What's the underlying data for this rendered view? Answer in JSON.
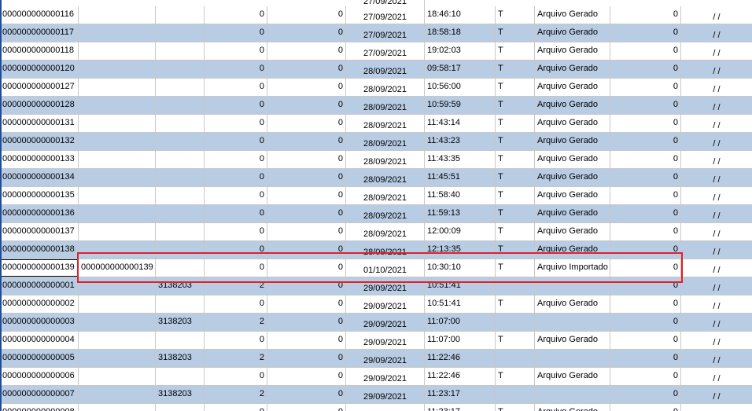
{
  "colors": {
    "row_alt": "#b8cce4",
    "row_plain": "#ffffff",
    "highlight": "#e0202a"
  },
  "top_partial_date": "27/09/2021",
  "rows": [
    {
      "c0": "000000000000116",
      "c1": "",
      "c2": "",
      "c3": "0",
      "c4": "0",
      "c5": "27/09/2021",
      "c6": "18:46:10",
      "c7": "T",
      "c8": "Arquivo Gerado",
      "c9": "0",
      "c10": "/ /"
    },
    {
      "c0": "000000000000117",
      "c1": "",
      "c2": "",
      "c3": "0",
      "c4": "0",
      "c5": "27/09/2021",
      "c6": "18:58:18",
      "c7": "T",
      "c8": "Arquivo Gerado",
      "c9": "0",
      "c10": "/ /"
    },
    {
      "c0": "000000000000118",
      "c1": "",
      "c2": "",
      "c3": "0",
      "c4": "0",
      "c5": "27/09/2021",
      "c6": "19:02:03",
      "c7": "T",
      "c8": "Arquivo Gerado",
      "c9": "0",
      "c10": "/ /"
    },
    {
      "c0": "000000000000120",
      "c1": "",
      "c2": "",
      "c3": "0",
      "c4": "0",
      "c5": "28/09/2021",
      "c6": "09:58:17",
      "c7": "T",
      "c8": "Arquivo Gerado",
      "c9": "0",
      "c10": "/ /"
    },
    {
      "c0": "000000000000127",
      "c1": "",
      "c2": "",
      "c3": "0",
      "c4": "0",
      "c5": "28/09/2021",
      "c6": "10:56:00",
      "c7": "T",
      "c8": "Arquivo Gerado",
      "c9": "0",
      "c10": "/ /"
    },
    {
      "c0": "000000000000128",
      "c1": "",
      "c2": "",
      "c3": "0",
      "c4": "0",
      "c5": "28/09/2021",
      "c6": "10:59:59",
      "c7": "T",
      "c8": "Arquivo Gerado",
      "c9": "0",
      "c10": "/ /"
    },
    {
      "c0": "000000000000131",
      "c1": "",
      "c2": "",
      "c3": "0",
      "c4": "0",
      "c5": "28/09/2021",
      "c6": "11:43:14",
      "c7": "T",
      "c8": "Arquivo Gerado",
      "c9": "0",
      "c10": "/ /"
    },
    {
      "c0": "000000000000132",
      "c1": "",
      "c2": "",
      "c3": "0",
      "c4": "0",
      "c5": "28/09/2021",
      "c6": "11:43:23",
      "c7": "T",
      "c8": "Arquivo Gerado",
      "c9": "0",
      "c10": "/ /"
    },
    {
      "c0": "000000000000133",
      "c1": "",
      "c2": "",
      "c3": "0",
      "c4": "0",
      "c5": "28/09/2021",
      "c6": "11:43:35",
      "c7": "T",
      "c8": "Arquivo Gerado",
      "c9": "0",
      "c10": "/ /"
    },
    {
      "c0": "000000000000134",
      "c1": "",
      "c2": "",
      "c3": "0",
      "c4": "0",
      "c5": "28/09/2021",
      "c6": "11:45:51",
      "c7": "T",
      "c8": "Arquivo Gerado",
      "c9": "0",
      "c10": "/ /"
    },
    {
      "c0": "000000000000135",
      "c1": "",
      "c2": "",
      "c3": "0",
      "c4": "0",
      "c5": "28/09/2021",
      "c6": "11:58:40",
      "c7": "T",
      "c8": "Arquivo Gerado",
      "c9": "0",
      "c10": "/ /"
    },
    {
      "c0": "000000000000136",
      "c1": "",
      "c2": "",
      "c3": "0",
      "c4": "0",
      "c5": "28/09/2021",
      "c6": "11:59:13",
      "c7": "T",
      "c8": "Arquivo Gerado",
      "c9": "0",
      "c10": "/ /"
    },
    {
      "c0": "000000000000137",
      "c1": "",
      "c2": "",
      "c3": "0",
      "c4": "0",
      "c5": "28/09/2021",
      "c6": "12:00:09",
      "c7": "T",
      "c8": "Arquivo Gerado",
      "c9": "0",
      "c10": "/ /"
    },
    {
      "c0": "000000000000138",
      "c1": "",
      "c2": "",
      "c3": "0",
      "c4": "0",
      "c5": "28/09/2021",
      "c6": "12:13:35",
      "c7": "T",
      "c8": "Arquivo Gerado",
      "c9": "0",
      "c10": "/ /"
    },
    {
      "c0": "000000000000139",
      "c1": "000000000000139",
      "c2": "",
      "c3": "0",
      "c4": "0",
      "c5": "01/10/2021",
      "c6": "10:30:10",
      "c7": "T",
      "c8": "Arquivo Importado",
      "c9": "0",
      "c10": "/ /",
      "selected": true
    },
    {
      "c0": "000000000000001",
      "c1": "",
      "c2": "3138203",
      "c3": "2",
      "c4": "0",
      "c5": "29/09/2021",
      "c6": "10:51:41",
      "c7": "",
      "c8": "",
      "c9": "0",
      "c10": "/ /"
    },
    {
      "c0": "000000000000002",
      "c1": "",
      "c2": "",
      "c3": "0",
      "c4": "0",
      "c5": "29/09/2021",
      "c6": "10:51:41",
      "c7": "T",
      "c8": "Arquivo Gerado",
      "c9": "0",
      "c10": "/ /"
    },
    {
      "c0": "000000000000003",
      "c1": "",
      "c2": "3138203",
      "c3": "2",
      "c4": "0",
      "c5": "29/09/2021",
      "c6": "11:07:00",
      "c7": "",
      "c8": "",
      "c9": "0",
      "c10": "/ /"
    },
    {
      "c0": "000000000000004",
      "c1": "",
      "c2": "",
      "c3": "0",
      "c4": "0",
      "c5": "29/09/2021",
      "c6": "11:07:00",
      "c7": "T",
      "c8": "Arquivo Gerado",
      "c9": "0",
      "c10": "/ /"
    },
    {
      "c0": "000000000000005",
      "c1": "",
      "c2": "3138203",
      "c3": "2",
      "c4": "0",
      "c5": "29/09/2021",
      "c6": "11:22:46",
      "c7": "",
      "c8": "",
      "c9": "0",
      "c10": "/ /"
    },
    {
      "c0": "000000000000006",
      "c1": "",
      "c2": "",
      "c3": "0",
      "c4": "0",
      "c5": "29/09/2021",
      "c6": "11:22:46",
      "c7": "T",
      "c8": "Arquivo Gerado",
      "c9": "0",
      "c10": "/ /"
    },
    {
      "c0": "000000000000007",
      "c1": "",
      "c2": "3138203",
      "c3": "2",
      "c4": "0",
      "c5": "29/09/2021",
      "c6": "11:23:17",
      "c7": "",
      "c8": "",
      "c9": "0",
      "c10": "/ /"
    },
    {
      "c0": "000000000000008",
      "c1": "",
      "c2": "",
      "c3": "0",
      "c4": "0",
      "c5": "29/09/2021",
      "c6": "11:23:17",
      "c7": "T",
      "c8": "Arquivo Gerado",
      "c9": "0",
      "c10": "/ /"
    }
  ]
}
